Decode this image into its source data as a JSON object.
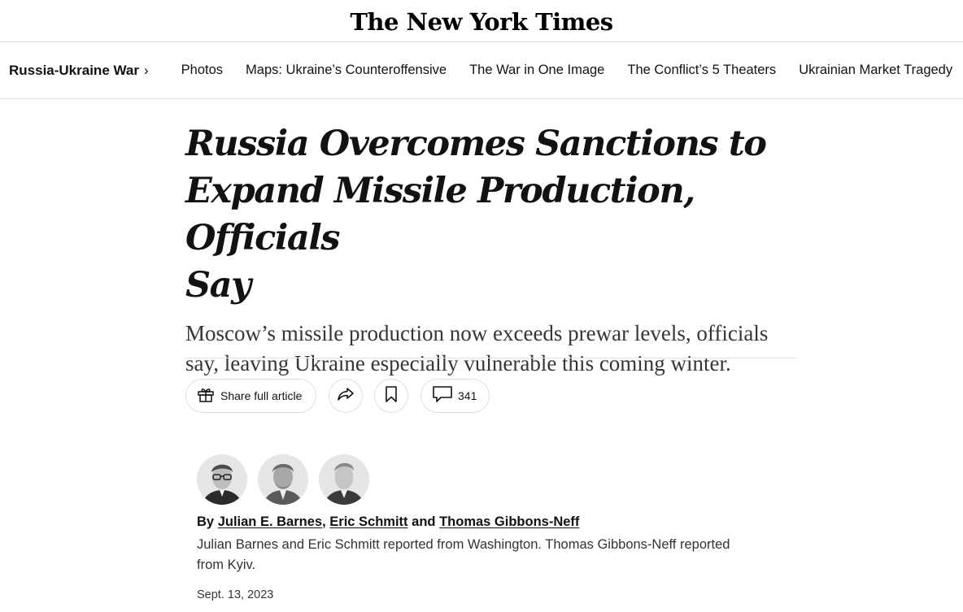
{
  "masthead": {
    "logo": "The New York Times"
  },
  "nav": {
    "section": "Russia-Ukraine War",
    "chevron": "›",
    "links": [
      "Photos",
      "Maps: Ukraine’s Counteroffensive",
      "The War in One Image",
      "The Conflict’s 5 Theaters",
      "Ukrainian Market Tragedy"
    ]
  },
  "article": {
    "headline_lines": [
      "Russia Overcomes Sanctions to",
      "Expand Missile Production, Officials",
      "Say"
    ],
    "summary_lines": [
      "Moscow’s missile production now exceeds prewar levels, officials",
      "say, leaving Ukraine especially vulnerable this coming winter."
    ],
    "actions": {
      "share_label": "Share full article",
      "comment_count": "341"
    },
    "byline": {
      "prefix": "By",
      "authors": [
        "Julian E. Barnes",
        "Eric Schmitt",
        "Thomas Gibbons-Neff"
      ],
      "sep1": ",",
      "sep2": "and"
    },
    "reported_lines": [
      "Julian Barnes and Eric Schmitt reported from Washington. Thomas Gibbons-Neff reported",
      "from Kyiv."
    ],
    "date": "Sept. 13, 2023"
  },
  "icons": [
    "gift-icon",
    "share-arrow-icon",
    "bookmark-icon",
    "comment-icon"
  ],
  "colors": {
    "text": "#121212",
    "border": "#dfdfdf",
    "summary": "#363636"
  }
}
